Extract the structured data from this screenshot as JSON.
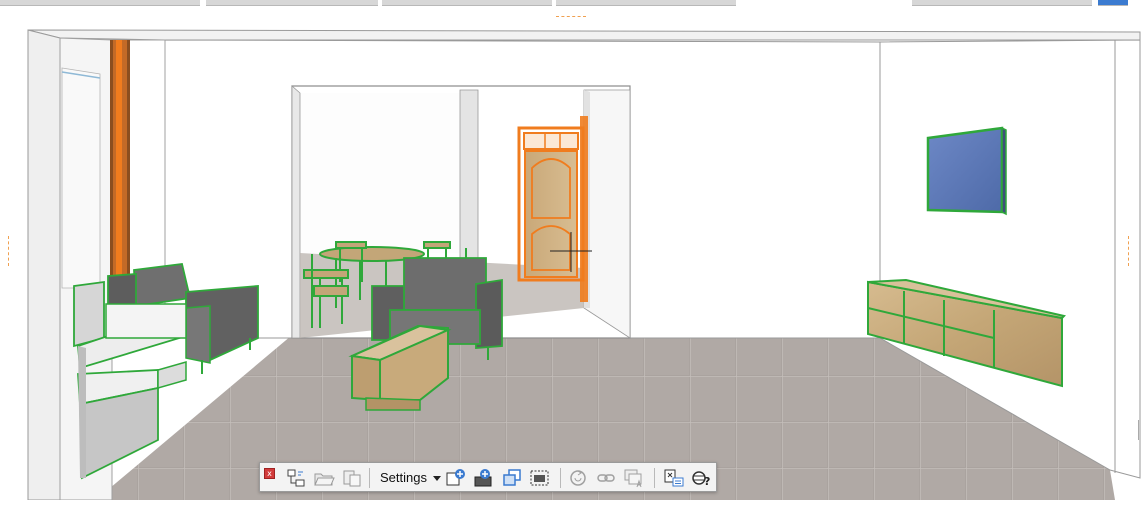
{
  "colors": {
    "selection_green": "#2fa83a",
    "selection_orange": "#f07c1e",
    "wall": "#ffffff",
    "floor": "#a9a29e",
    "sofa": "#6b6b6b",
    "wood": "#c9ab7c"
  },
  "view_toolbar": {
    "close_label": "x",
    "settings_label": "Settings",
    "buttons": [
      {
        "icon": "hierarchy-icon"
      },
      {
        "icon": "open-folder-icon"
      },
      {
        "icon": "paste-icon"
      },
      {
        "icon": "zoom-in-icon"
      },
      {
        "icon": "add-layer-icon"
      },
      {
        "icon": "layers-icon"
      },
      {
        "icon": "selection-frame-icon"
      },
      {
        "icon": "refresh-icon"
      },
      {
        "icon": "link-icon"
      },
      {
        "icon": "text-image-icon"
      },
      {
        "icon": "list-icon"
      },
      {
        "icon": "help-icon"
      }
    ]
  }
}
